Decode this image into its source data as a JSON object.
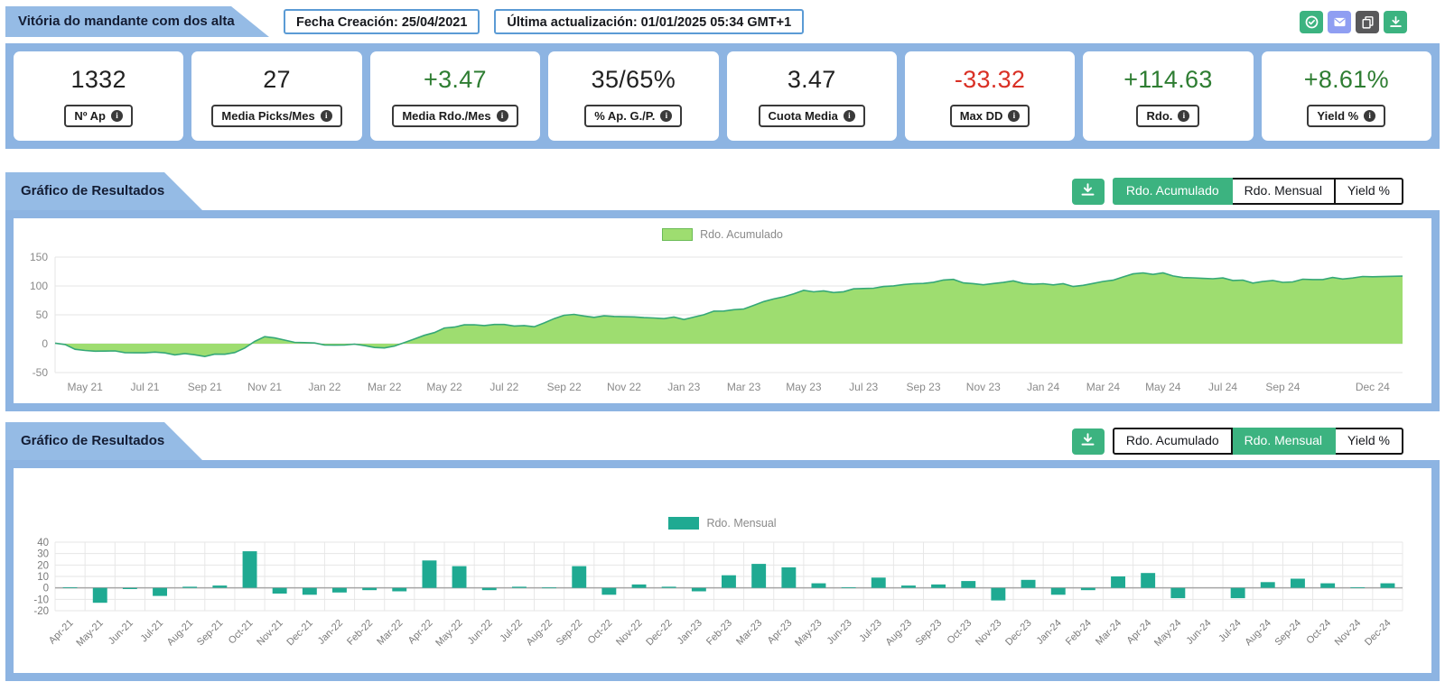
{
  "header": {
    "title": "Vitória do mandante com dos alta",
    "created": "Fecha Creación: 25/04/2021",
    "updated": "Última actualización: 01/01/2025 05:34 GMT+1",
    "icons": [
      "check-circle-icon",
      "envelope-icon",
      "copy-icon",
      "download-icon"
    ]
  },
  "colors": {
    "band_blue": "#8db4e2",
    "tab_blue": "#95bbe5",
    "green": "#3cb380",
    "purple": "#8f9ef2",
    "dark_gray": "#58585a",
    "area_fill": "#9edd70",
    "area_line": "#35a877",
    "bar_teal": "#1faa92",
    "value_green": "#2e7d32",
    "value_red": "#d93025",
    "value_dark": "#212121"
  },
  "stats": {
    "cards": [
      {
        "value": "1332",
        "label": "Nº Ap",
        "color": "#212121"
      },
      {
        "value": "27",
        "label": "Media Picks/Mes",
        "color": "#212121"
      },
      {
        "value": "+3.47",
        "label": "Media Rdo./Mes",
        "color": "#2e7d32"
      },
      {
        "value": "35/65%",
        "label": "% Ap. G./P.",
        "color": "#212121"
      },
      {
        "value": "3.47",
        "label": "Cuota Media",
        "color": "#212121"
      },
      {
        "value": "-33.32",
        "label": "Max DD",
        "color": "#d93025"
      },
      {
        "value": "+114.63",
        "label": "Rdo.",
        "color": "#2e7d32"
      },
      {
        "value": "+8.61%",
        "label": "Yield %",
        "color": "#2e7d32"
      }
    ]
  },
  "sections": [
    {
      "title": "Gráfico de Resultados",
      "download_icon": "download-icon",
      "tabs": [
        {
          "label": "Rdo. Acumulado",
          "active": true
        },
        {
          "label": "Rdo. Mensual",
          "active": false
        },
        {
          "label": "Yield %",
          "active": false
        }
      ]
    },
    {
      "title": "Gráfico de Resultados",
      "download_icon": "download-icon",
      "tabs": [
        {
          "label": "Rdo. Acumulado",
          "active": false
        },
        {
          "label": "Rdo. Mensual",
          "active": true
        },
        {
          "label": "Yield %",
          "active": false
        }
      ]
    }
  ],
  "chart_data": [
    {
      "type": "area",
      "legend_label": "Rdo. Acumulado",
      "legend_position": "top",
      "grid": true,
      "x": [
        "Apr-21",
        "May-21",
        "Jun-21",
        "Jul-21",
        "Aug-21",
        "Sep-21",
        "Oct-21",
        "Nov-21",
        "Dec-21",
        "Jan-22",
        "Feb-22",
        "Mar-22",
        "Apr-22",
        "May-22",
        "Jun-22",
        "Jul-22",
        "Aug-22",
        "Sep-22",
        "Oct-22",
        "Nov-22",
        "Dec-22",
        "Jan-23",
        "Feb-23",
        "Mar-23",
        "Apr-23",
        "May-23",
        "Jun-23",
        "Jul-23",
        "Aug-23",
        "Sep-23",
        "Oct-23",
        "Nov-23",
        "Dec-23",
        "Jan-24",
        "Feb-24",
        "Mar-24",
        "Apr-24",
        "May-24",
        "Jun-24",
        "Jul-24",
        "Aug-24",
        "Sep-24",
        "Oct-24",
        "Nov-24",
        "Dec-24"
      ],
      "values": [
        1,
        -12,
        -13,
        -16,
        -18,
        -22,
        -16,
        12,
        4,
        0,
        -3,
        -7,
        6,
        26,
        33,
        32,
        31,
        51,
        46,
        48,
        46,
        44,
        56,
        61,
        79,
        92,
        90,
        96,
        102,
        105,
        110,
        101,
        107,
        104,
        101,
        106,
        120,
        122,
        114,
        112,
        106,
        108,
        112,
        113,
        116
      ],
      "tick_indices": [
        1,
        3,
        5,
        7,
        9,
        11,
        13,
        15,
        17,
        19,
        21,
        23,
        25,
        27,
        29,
        31,
        33,
        35,
        37,
        39,
        41,
        44
      ],
      "tick_labels": [
        "May 21",
        "Jul 21",
        "Sep 21",
        "Nov 21",
        "Jan 22",
        "Mar 22",
        "May 22",
        "Jul 22",
        "Sep 22",
        "Nov 22",
        "Jan 23",
        "Mar 23",
        "May 23",
        "Jul 23",
        "Sep 23",
        "Nov 23",
        "Jan 24",
        "Mar 24",
        "May 24",
        "Jul 24",
        "Sep 24",
        "Dec 24"
      ],
      "ylim": [
        -50,
        150
      ],
      "yticks": [
        150,
        100,
        50,
        0,
        -50
      ],
      "fill": "#9edd70",
      "line": "#35a877"
    },
    {
      "type": "bar",
      "legend_label": "Rdo. Mensual",
      "legend_position": "top",
      "grid": true,
      "categories": [
        "Apr-21",
        "May-21",
        "Jun-21",
        "Jul-21",
        "Aug-21",
        "Sep-21",
        "Oct-21",
        "Nov-21",
        "Dec-21",
        "Jan-22",
        "Feb-22",
        "Mar-22",
        "Apr-22",
        "May-22",
        "Jun-22",
        "Jul-22",
        "Aug-22",
        "Sep-22",
        "Oct-22",
        "Nov-22",
        "Dec-22",
        "Jan-23",
        "Feb-23",
        "Mar-23",
        "Apr-23",
        "May-23",
        "Jun-23",
        "Jul-23",
        "Aug-23",
        "Sep-23",
        "Oct-23",
        "Nov-23",
        "Dec-23",
        "Jan-24",
        "Feb-24",
        "Mar-24",
        "Apr-24",
        "May-24",
        "Jun-24",
        "Jul-24",
        "Aug-24",
        "Sep-24",
        "Oct-24",
        "Nov-24",
        "Dec-24"
      ],
      "values": [
        0.4,
        -13,
        -1,
        -7,
        1,
        2,
        32,
        -5,
        -6,
        -4,
        -2,
        -3,
        24,
        19,
        -2,
        1,
        0.3,
        19,
        -6,
        3,
        1,
        -3,
        11,
        21,
        18,
        4,
        0.5,
        9,
        2,
        3,
        6,
        -11,
        7,
        -6,
        -2,
        10,
        13,
        -9,
        0,
        -9,
        5,
        8,
        4,
        0.5,
        4
      ],
      "ylim": [
        -20,
        40
      ],
      "yticks": [
        40,
        30,
        20,
        10,
        0,
        -10,
        -20
      ],
      "color": "#1faa92"
    }
  ]
}
